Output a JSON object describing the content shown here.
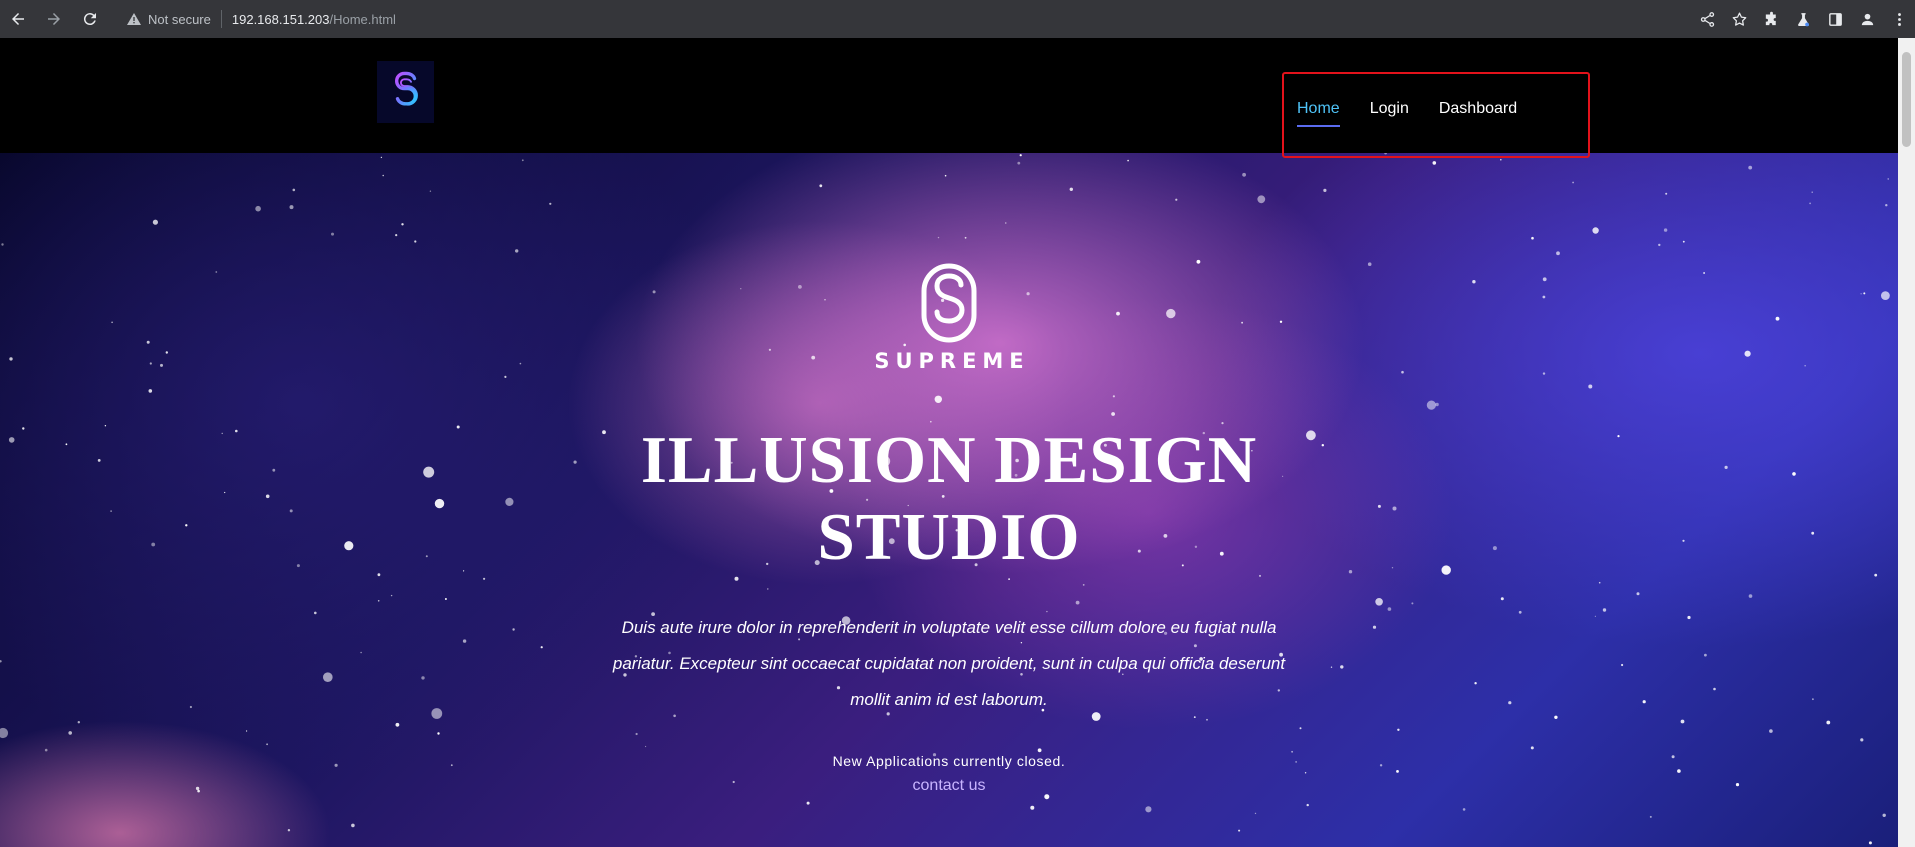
{
  "browser": {
    "security_label": "Not secure",
    "url_host": "192.168.151.203",
    "url_path": "/Home.html"
  },
  "nav": {
    "items": [
      {
        "label": "Home",
        "active": true
      },
      {
        "label": "Login",
        "active": false
      },
      {
        "label": "Dashboard",
        "active": false
      }
    ]
  },
  "hero": {
    "brand_name": "SUPREME",
    "title_line1": "ILLUSION DESIGN",
    "title_line2": "STUDIO",
    "desc_line1": "Duis aute irure dolor in reprehenderit in voluptate velit esse cillum dolore eu fugiat nulla",
    "desc_line2": "pariatur. Excepteur sint occaecat cupidatat non proident, sunt in culpa qui officia deserunt",
    "desc_line3": "mollit anim id est laborum.",
    "closed_note": "New Applications currently closed.",
    "contact_label": "contact us"
  },
  "colors": {
    "nav_active": "#4fc3f7",
    "nav_highlight_box": "#e3121b",
    "contact_link": "#c8b4ff"
  }
}
